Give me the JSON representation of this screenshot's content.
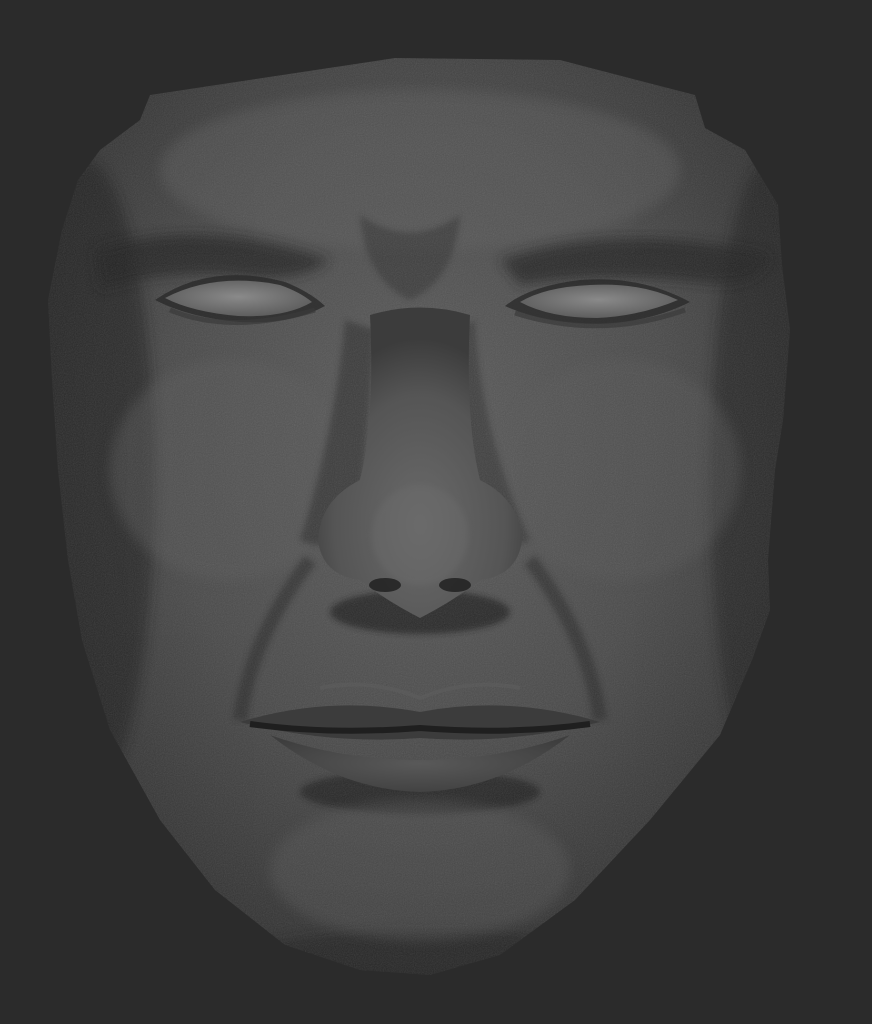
{
  "viewport": {
    "background_color": "#2b2b2b"
  },
  "sculpt": {
    "subject": "face-mask-sculpt",
    "material_base_color": "#4a4a4a",
    "material_highlight_color": "#5e5e5e",
    "material_shadow_color": "#1f1f1f",
    "eye_color": "#7a7a7a"
  }
}
